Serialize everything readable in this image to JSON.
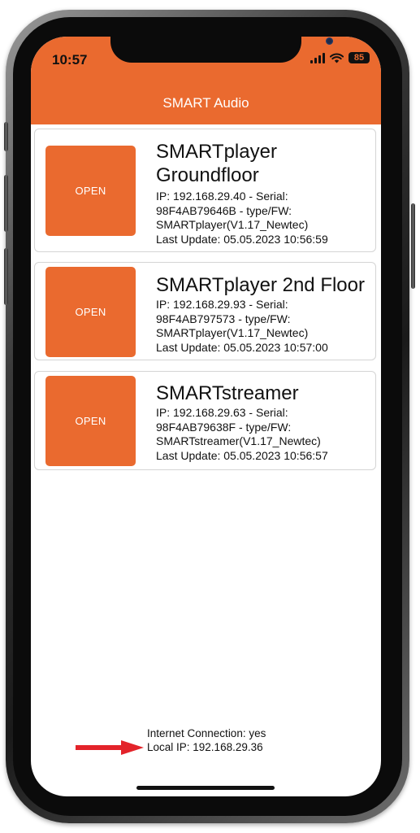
{
  "status_bar": {
    "time": "10:57",
    "battery": "85"
  },
  "header": {
    "title": "SMART Audio"
  },
  "devices": [
    {
      "name": "SMARTplayer Groundfloor",
      "open_label": "OPEN",
      "info": "IP: 192.168.29.40 - Serial:\n98F4AB79646B - type/FW:\nSMARTplayer(V1.17_Newtec)\nLast Update: 05.05.2023 10:56:59"
    },
    {
      "name": "SMARTplayer 2nd Floor",
      "open_label": "OPEN",
      "info": "IP: 192.168.29.93 - Serial:\n98F4AB797573 - type/FW:\nSMARTplayer(V1.17_Newtec)\nLast Update: 05.05.2023 10:57:00"
    },
    {
      "name": "SMARTstreamer",
      "open_label": "OPEN",
      "info": "IP: 192.168.29.63 - Serial:\n98F4AB79638F - type/FW:\nSMARTstreamer(V1.17_Newtec)\nLast Update: 05.05.2023 10:56:57"
    }
  ],
  "footer": {
    "internet": "Internet Connection: yes",
    "local_ip": "Local IP: 192.168.29.36"
  },
  "colors": {
    "accent": "#ea6a2f",
    "annotation_arrow": "#e3232a"
  },
  "icons": [
    "signal-icon",
    "wifi-icon",
    "battery-icon",
    "arrow-annotation-icon"
  ]
}
